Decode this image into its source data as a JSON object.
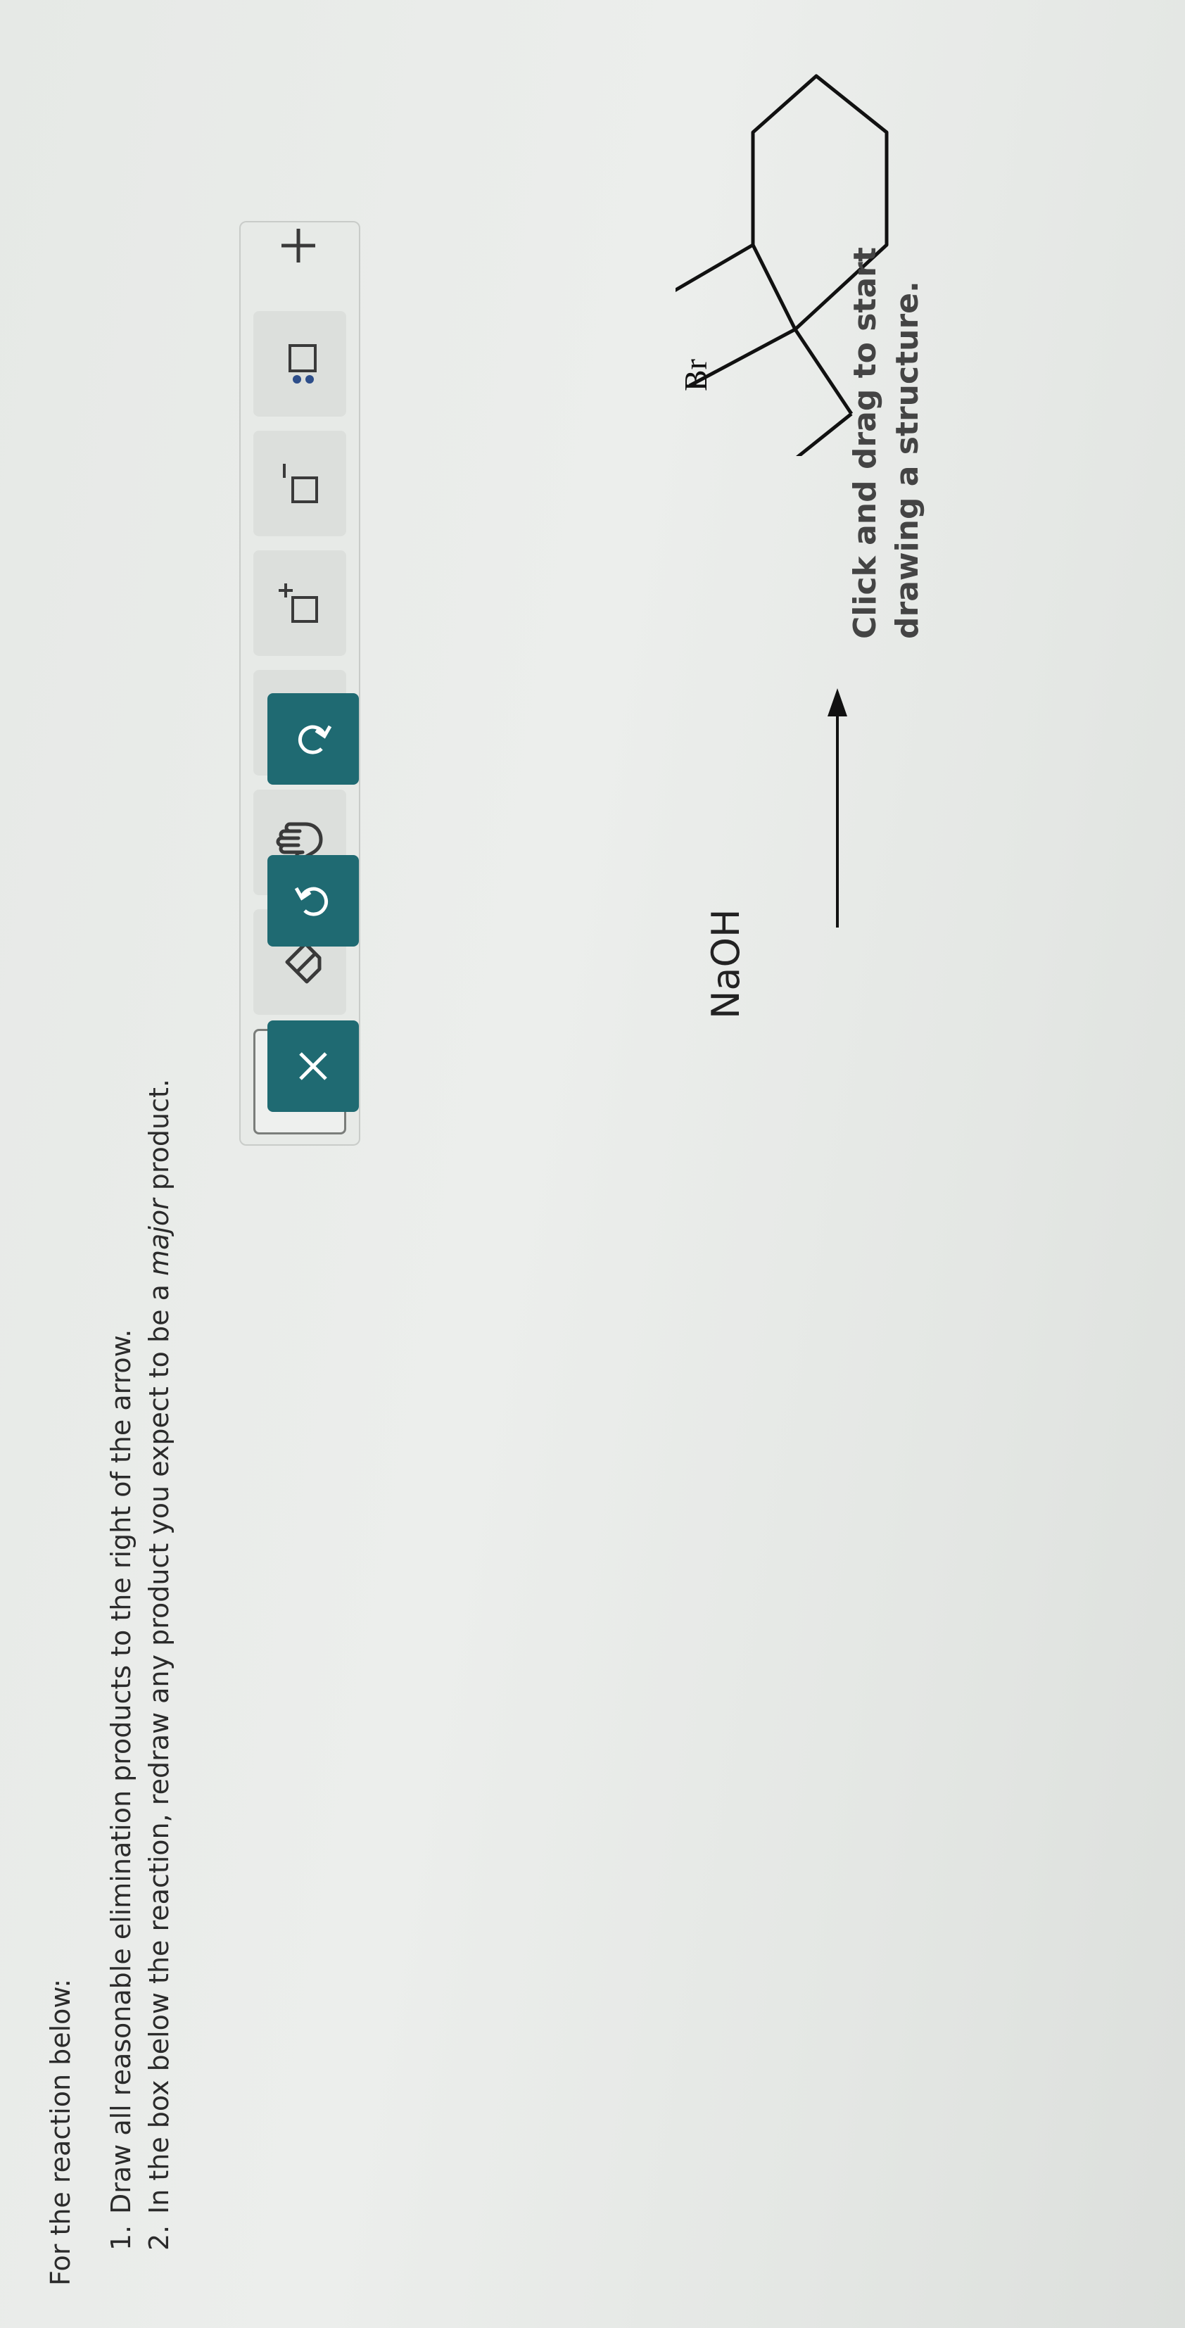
{
  "intro": "For the reaction below:",
  "instructions": [
    {
      "num": "1.",
      "text": "Draw all reasonable elimination products to the right of the arrow."
    },
    {
      "num": "2.",
      "text_before": "In the box below the reaction, redraw any product you expect to be a ",
      "emphasis": "major",
      "text_after": " product."
    }
  ],
  "toolbar": {
    "tools": [
      {
        "name": "pencil-icon",
        "state": "selected"
      },
      {
        "name": "eraser-icon",
        "state": "normal"
      },
      {
        "name": "hand-icon",
        "state": "normal"
      },
      {
        "name": "selection-box-icon",
        "state": "normal"
      },
      {
        "name": "positive-charge-icon",
        "state": "normal",
        "symbol": "+"
      },
      {
        "name": "negative-charge-icon",
        "state": "normal",
        "symbol": "−"
      },
      {
        "name": "lone-pair-icon",
        "state": "normal"
      },
      {
        "name": "plus-icon",
        "state": "plain",
        "symbol": "+"
      },
      {
        "name": "clear-icon",
        "state": "action",
        "symbol": "×"
      },
      {
        "name": "undo-icon",
        "state": "action"
      },
      {
        "name": "redo-icon",
        "state": "action"
      }
    ],
    "action_color": "#1f6a72"
  },
  "reaction": {
    "reagent": "NaOH",
    "substituent_label": "Br"
  },
  "canvas_hint": {
    "line1": "Click and drag to start",
    "line2": "drawing a structure."
  }
}
